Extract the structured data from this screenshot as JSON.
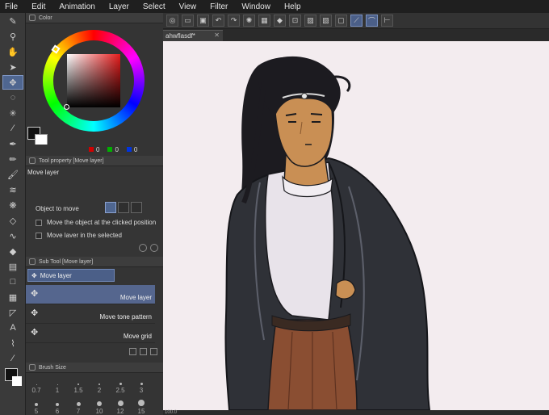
{
  "menu": [
    "File",
    "Edit",
    "Animation",
    "Layer",
    "Select",
    "View",
    "Filter",
    "Window",
    "Help"
  ],
  "panels": {
    "color": {
      "title": "Color",
      "r": "0",
      "g": "0",
      "b": "0"
    },
    "tool_property": {
      "title": "Tool property [Move layer]",
      "tool_name": "Move layer",
      "object_to_move_label": "Object to move",
      "option1": "Move the object at the clicked position",
      "option2": "Move layer in the selected"
    },
    "sub_tool": {
      "title": "Sub Tool [Move layer]",
      "active_tab": "Move layer",
      "items": [
        {
          "label": "Move layer",
          "selected": true
        },
        {
          "label": "Move tone pattern",
          "selected": false
        },
        {
          "label": "Move grid",
          "selected": false
        }
      ]
    },
    "brush_size": {
      "title": "Brush Size",
      "sizes": [
        "0.7",
        "1",
        "1.5",
        "2",
        "2.5",
        "3",
        "5",
        "6",
        "7",
        "10",
        "12",
        "15"
      ]
    }
  },
  "document_tab": {
    "name": "ahwflasdf*"
  },
  "status": {
    "zoom": "100.0"
  },
  "colors": {
    "accent": "#4f6690",
    "canvas_bg": "#f3ecef",
    "skin": "#c98f54",
    "coat": "#2f3137",
    "hair": "#1c1b20",
    "shirt": "#e8e3ea",
    "skirt": "#8a4e32"
  }
}
